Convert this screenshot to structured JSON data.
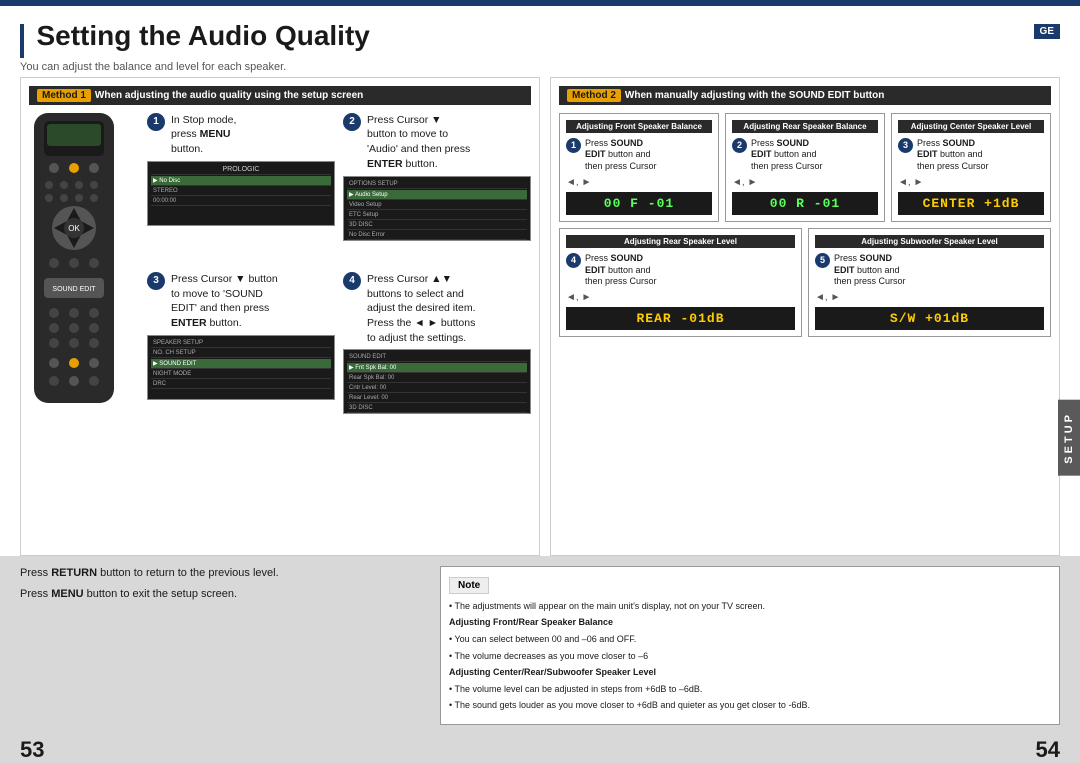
{
  "page": {
    "title": "Setting the Audio Quality",
    "subtitle": "You can adjust the balance and level for each speaker.",
    "badge": "GE",
    "page_left": "53",
    "page_right": "54"
  },
  "method1": {
    "label": "Method",
    "number": "1",
    "title": "When adjusting the audio quality using the setup screen",
    "steps": [
      {
        "num": "1",
        "text_line1": "In Stop mode,",
        "text_line2": "press ",
        "text_bold": "MENU",
        "text_line3": "button."
      },
      {
        "num": "2",
        "text_line1": "Press Cursor ▼",
        "text_line2": "button to move to",
        "text_line3": "'Audio' and then press",
        "text_bold": "ENTER",
        "text_line4": "button."
      },
      {
        "num": "3",
        "text_line1": "Press Cursor ▼ button",
        "text_line2": "to move to 'SOUND",
        "text_line3": "EDIT' and then press",
        "text_bold": "ENTER",
        "text_line4": "button."
      },
      {
        "num": "4",
        "text_line1": "Press Cursor ▲▼",
        "text_line2": "buttons to select and",
        "text_line3": "adjust the desired item.",
        "text_line4": "Press the ◄ ► buttons",
        "text_line5": "to adjust the settings."
      }
    ]
  },
  "method2": {
    "label": "Method",
    "number": "2",
    "title": "When manually adjusting with the SOUND EDIT button",
    "sections_row1": [
      {
        "id": "front-balance",
        "title": "Adjusting Front Speaker Balance",
        "step_num": "1",
        "step_text": "Press SOUND EDIT button and then press Cursor",
        "arrows": "◄, ►",
        "display": "00 F  -01"
      },
      {
        "id": "rear-balance",
        "title": "Adjusting Rear Speaker Balance",
        "step_num": "2",
        "step_text": "Press SOUND EDIT button and then press Cursor",
        "arrows": "◄, ►",
        "display": "00 R  -01"
      },
      {
        "id": "center-level",
        "title": "Adjusting Center Speaker Level",
        "step_num": "3",
        "step_text": "Press SOUND EDIT button and then press Cursor",
        "arrows": "◄, ►",
        "display": "CENTER +1dB"
      }
    ],
    "sections_row2": [
      {
        "id": "rear-level",
        "title": "Adjusting Rear Speaker Level",
        "step_num": "4",
        "step_text": "Press SOUND EDIT button and then press Cursor",
        "arrows": "◄, ►",
        "display": "REAR  -01dB"
      },
      {
        "id": "sub-level",
        "title": "Adjusting Subwoofer Speaker Level",
        "step_num": "5",
        "step_text": "Press SOUND EDIT button and then press Cursor",
        "arrows": "◄, ►",
        "display": "S/W  +01dB"
      }
    ]
  },
  "bottom": {
    "return_text": "Press ",
    "return_bold": "RETURN",
    "return_rest": " button to return to the previous level.",
    "menu_text": "Press ",
    "menu_bold": "MENU",
    "menu_rest": " button to exit the setup screen.",
    "note_header": "Note",
    "notes": [
      "• The adjustments will appear on the main unit's display, not on your TV screen.",
      "Adjusting Front/Rear Speaker Balance",
      "• You can select between 00 and –06 and OFF.",
      "• The volume decreases as you move closer to –6",
      "Adjusting Center/Rear/Subwoofer Speaker Level",
      "• The volume level can be adjusted in steps from +6dB to –6dB.",
      "• The sound gets louder as you move closer to +6dB and quieter as you get closer to -6dB."
    ]
  },
  "setup_tab": "SETUP"
}
